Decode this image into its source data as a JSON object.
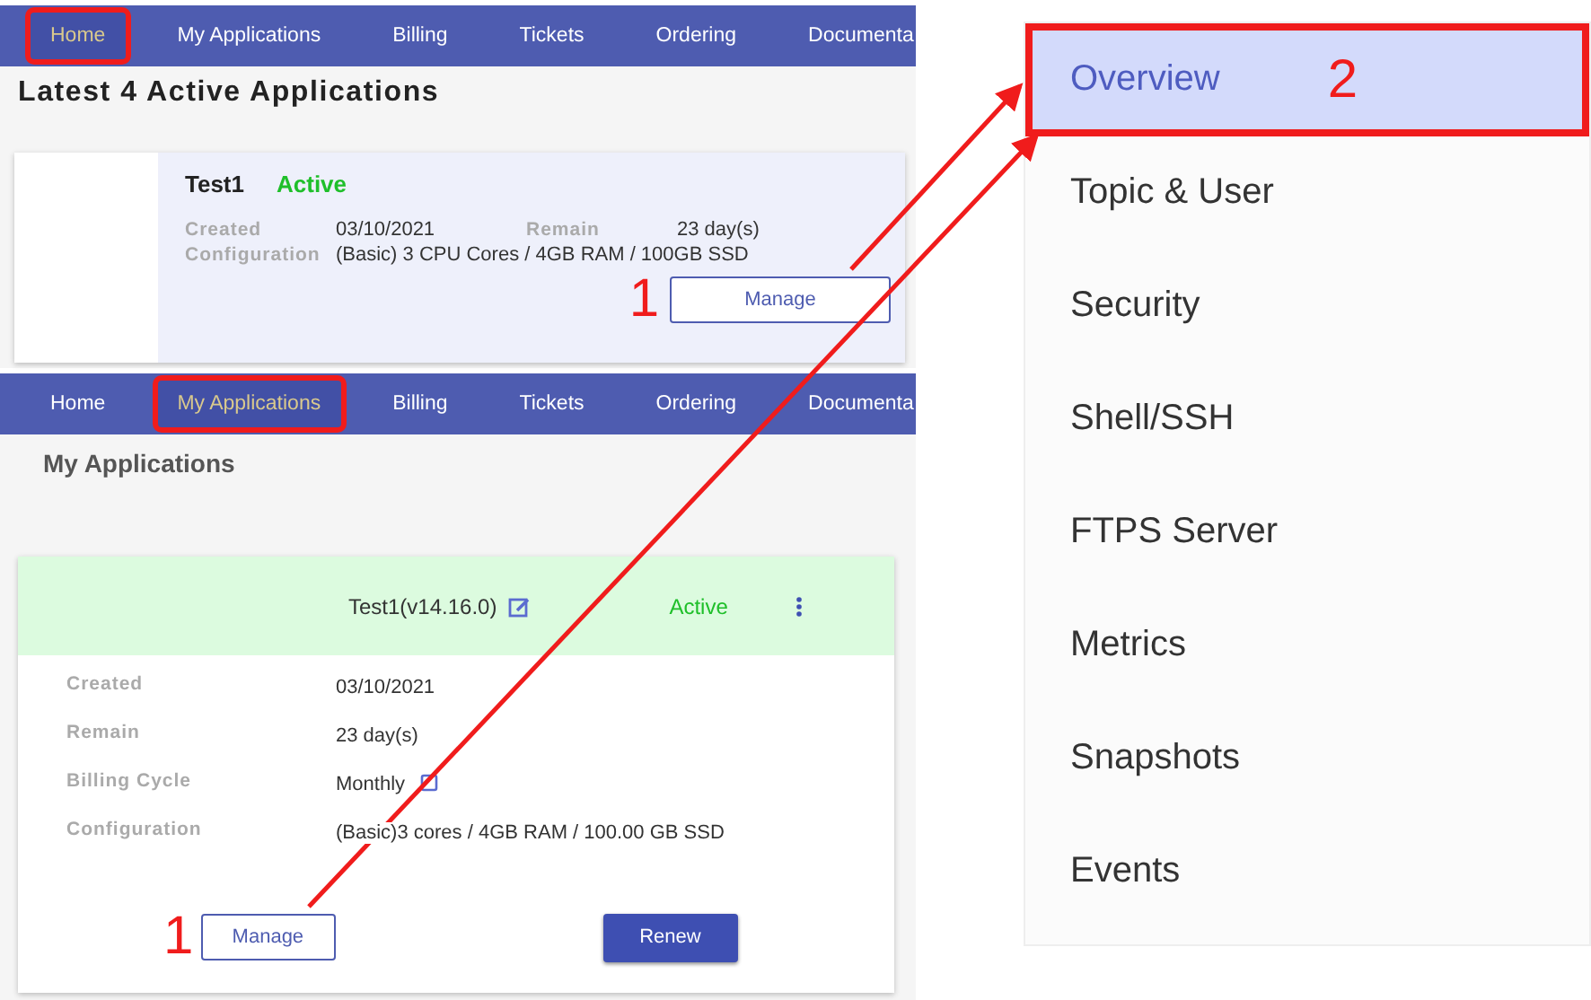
{
  "home": {
    "nav": [
      {
        "label": "Home",
        "selected": true,
        "highlighted": true
      },
      {
        "label": "My Applications",
        "selected": false,
        "highlighted": false
      },
      {
        "label": "Billing",
        "selected": false,
        "highlighted": false
      },
      {
        "label": "Tickets",
        "selected": false,
        "highlighted": false
      },
      {
        "label": "Ordering",
        "selected": false,
        "highlighted": false
      },
      {
        "label": "Documenta",
        "selected": false,
        "highlighted": false
      }
    ],
    "heading": "Latest 4 Active Applications",
    "card": {
      "name": "Test1",
      "status": "Active",
      "fields": [
        {
          "label": "Created",
          "value": "03/10/2021"
        },
        {
          "label": "Remain",
          "value": "23 day(s)"
        },
        {
          "label": "Configuration",
          "value": "(Basic) 3 CPU Cores / 4GB RAM / 100GB SSD"
        }
      ],
      "button": "Manage",
      "callout": "1"
    }
  },
  "applications": {
    "nav": [
      {
        "label": "Home",
        "selected": false,
        "highlighted": false
      },
      {
        "label": "My Applications",
        "selected": true,
        "highlighted": true
      },
      {
        "label": "Billing",
        "selected": false,
        "highlighted": false
      },
      {
        "label": "Tickets",
        "selected": false,
        "highlighted": false
      },
      {
        "label": "Ordering",
        "selected": false,
        "highlighted": false
      },
      {
        "label": "Documenta",
        "selected": false,
        "highlighted": false
      }
    ],
    "heading": "My Applications",
    "card": {
      "name": "Test1(v14.16.0)",
      "status": "Active",
      "fields": [
        {
          "label": "Created",
          "value": "03/10/2021"
        },
        {
          "label": "Remain",
          "value": "23 day(s)"
        },
        {
          "label": "Billing Cycle",
          "value": "Monthly",
          "editable": true
        },
        {
          "label": "Configuration",
          "value": "(Basic)3 cores / 4GB RAM / 100.00 GB SSD"
        }
      ],
      "buttons": [
        {
          "label": "Manage",
          "kind": "outline",
          "callout": "1"
        },
        {
          "label": "Renew",
          "kind": "filled"
        }
      ]
    }
  },
  "sidebar": {
    "items": [
      {
        "label": "Overview",
        "selected": true,
        "highlighted": true,
        "callout": "2"
      },
      {
        "label": "Topic & User",
        "selected": false,
        "highlighted": false
      },
      {
        "label": "Security",
        "selected": false,
        "highlighted": false
      },
      {
        "label": "Shell/SSH",
        "selected": false,
        "highlighted": false
      },
      {
        "label": "FTPS Server",
        "selected": false,
        "highlighted": false
      },
      {
        "label": "Metrics",
        "selected": false,
        "highlighted": false
      },
      {
        "label": "Snapshots",
        "selected": false,
        "highlighted": false
      },
      {
        "label": "Events",
        "selected": false,
        "highlighted": false
      }
    ]
  }
}
